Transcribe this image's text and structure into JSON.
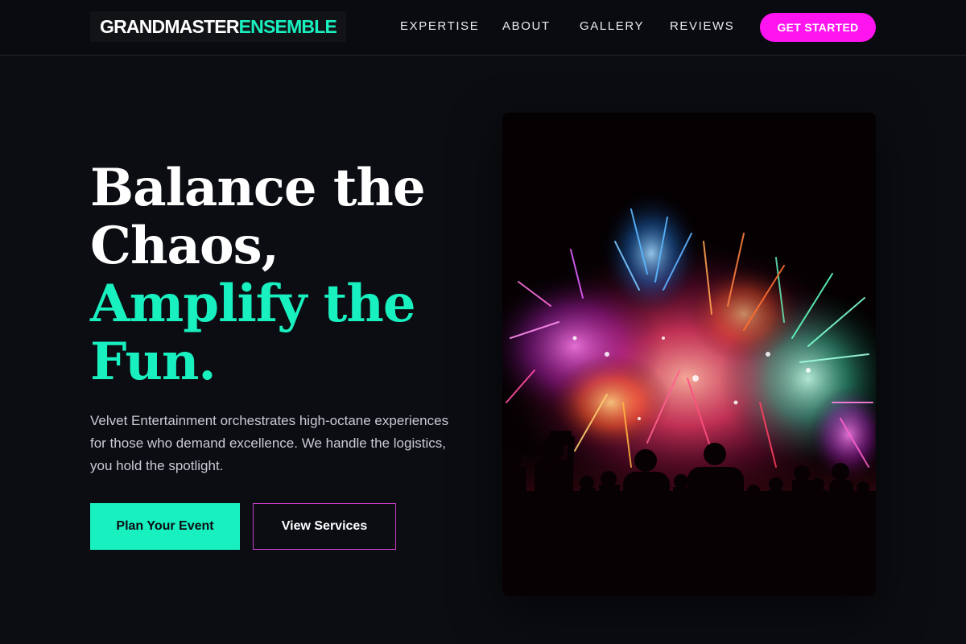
{
  "brand": {
    "logo_part1": "GRANDMASTER",
    "logo_part2": "ENSEMBLE"
  },
  "nav": {
    "items": [
      {
        "label": "EXPERTISE"
      },
      {
        "label": "ABOUT"
      },
      {
        "label": "GALLERY"
      },
      {
        "label": "REVIEWS"
      }
    ],
    "cta_label": "GET STARTED"
  },
  "hero": {
    "headline_line1": "Balance the",
    "headline_line2": "Chaos,",
    "headline_line3": "Amplify the",
    "headline_line4": "Fun.",
    "description": "Velvet Entertainment orchestrates high-octane experiences for those who demand excellence. We handle the logistics, you hold the spotlight.",
    "primary_button": "Plan Your Event",
    "secondary_button": "View Services",
    "image_icon": "fireworks-crowd-photo"
  },
  "colors": {
    "background": "#0b0d12",
    "accent_green": "#19f0c0",
    "accent_magenta": "#ff14f0",
    "text_muted": "#c9ccd3"
  }
}
